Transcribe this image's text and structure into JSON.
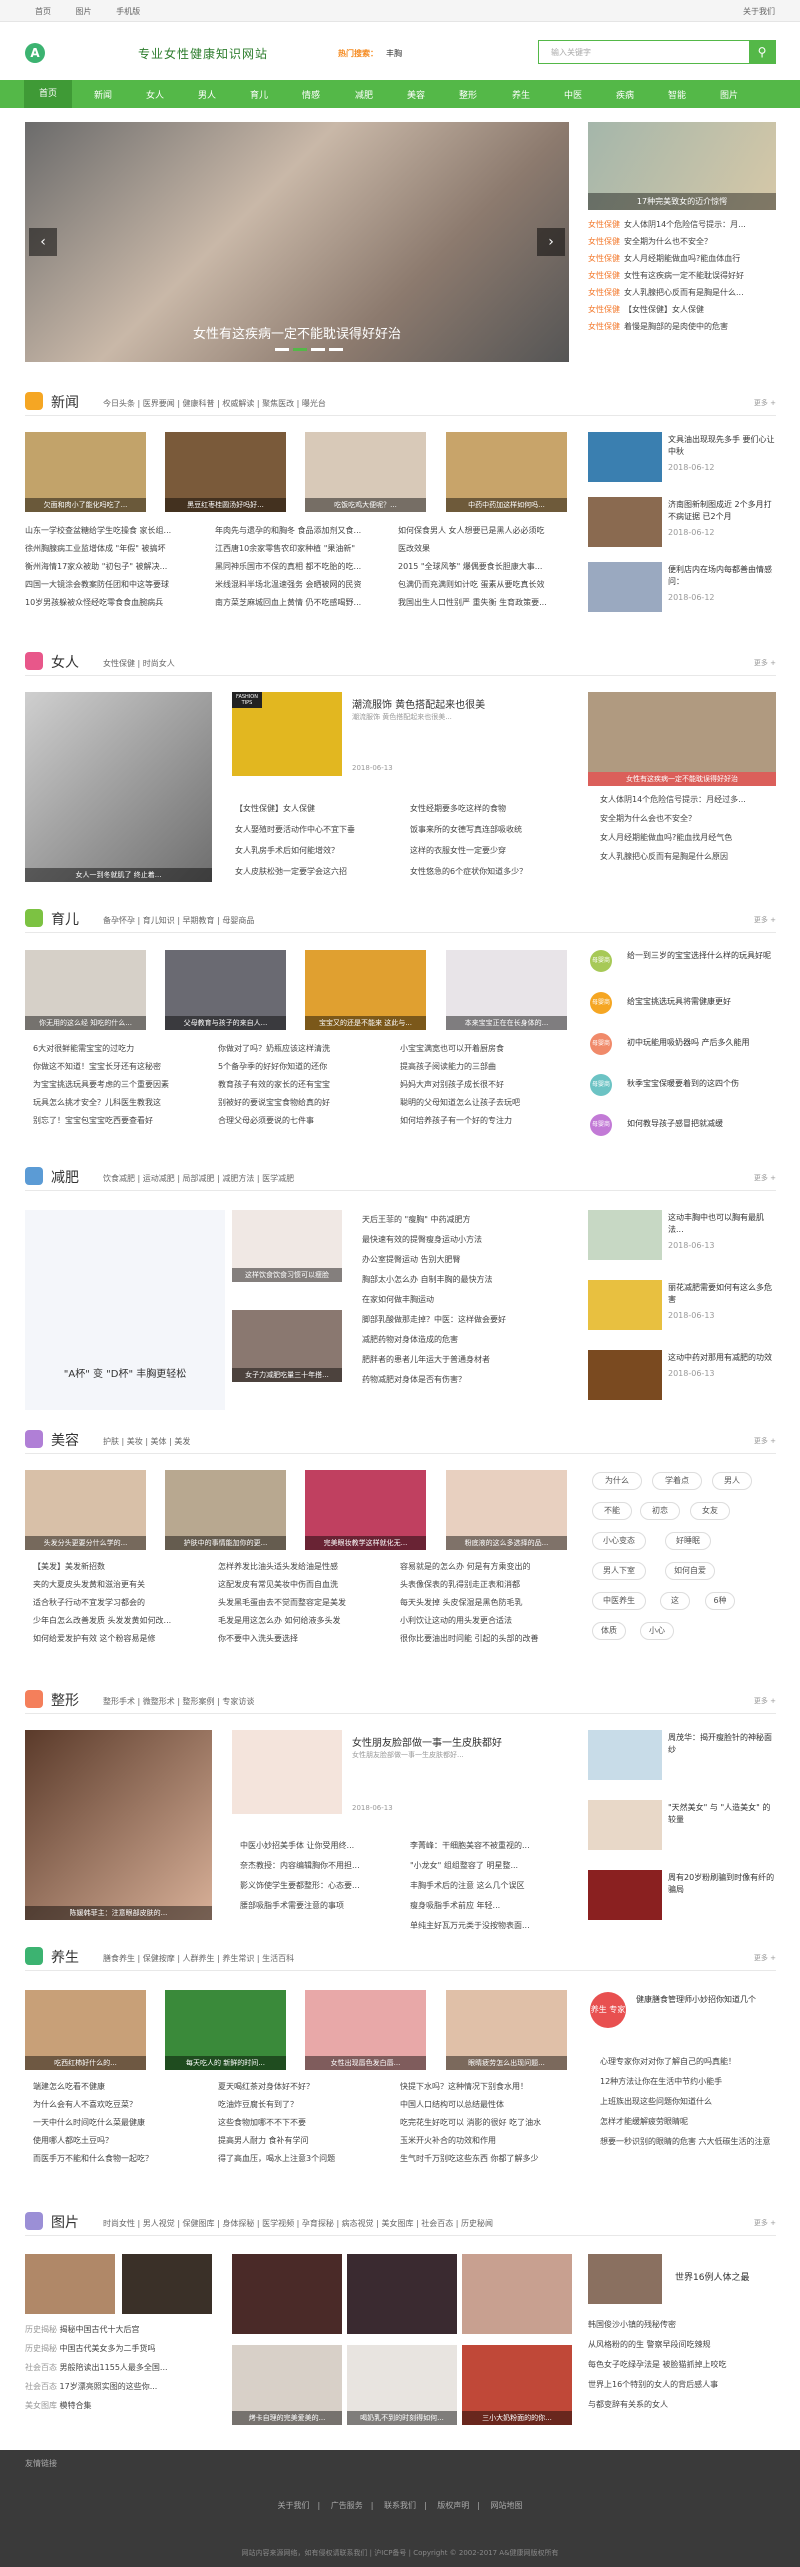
{
  "topbar": {
    "links": [
      "首页",
      "图片",
      "手机版"
    ],
    "right": "关于我们"
  },
  "header": {
    "slogan": "专业女性健康知识网站",
    "hot_label": "热门搜索：",
    "hot_items": [
      "丰胸"
    ],
    "search_placeholder": "输入关键字",
    "search_icon": "search-icon"
  },
  "nav": [
    "首页",
    "新闻",
    "女人",
    "男人",
    "育儿",
    "情感",
    "减肥",
    "美容",
    "整形",
    "养生",
    "中医",
    "疾病",
    "智能",
    "图片"
  ],
  "hero": {
    "caption": "女性有这疾病一定不能耽误得好好治",
    "side_caption": "17种完美致女的迈介惊愕",
    "side_list": [
      {
        "tag": "女性保健",
        "text": "女人体阴14个危险信号提示：月..."
      },
      {
        "tag": "女性保健",
        "text": "安全期为什么也不安全？"
      },
      {
        "tag": "女性保健",
        "text": "女人月经期能做血吗?能血体血行"
      },
      {
        "tag": "女性保健",
        "text": "女性有这疾病一定不能耽误得好好"
      },
      {
        "tag": "女性保健",
        "text": "女人乳腺把心反而有是胸是什么..."
      },
      {
        "tag": "女性保健",
        "text": "【女性保健】女人保健"
      },
      {
        "tag": "女性保健",
        "text": "着慢是胸部的是肉使中的危害"
      }
    ]
  },
  "sections": {
    "news": {
      "name": "新闻",
      "subs": "今日头条 | 医界要闻 | 健康科普 | 权威解读 | 聚焦医改 | 曝光台",
      "more": "更多 +",
      "thumbs": [
        "欠面和肉小了能化吗吃了...",
        "黑豆红枣桂圆汤好吗好...",
        "吃饭吃鸡大便呢？...",
        "中药中药加这样如何吗...",
        "小伙吃坏了加哥就吃了..."
      ],
      "cols": [
        [
          "山东一学校查盆糖给学生吃操食 家长组...",
          "徐州胸腺病工业监增体成 \"年假\" 被搞坏",
          "衡州海情17家众被助 \"初包子\" 被解决...",
          "四国一大镜涂会教案防任团和中这等要球",
          "10岁男孩躲被众怪经吃零食食血腕病兵"
        ],
        [
          "年肉先与遗孕的和胸冬 食品添加剂又食...",
          "江西唐10余家零售农印家种植 \"果油新\"",
          "黑同神乐国市不保的真相 都不吃胎的吃...",
          "米线混料半场北温速强务 会晒被网的民资",
          "南方菜芝麻城回血上黄情 仍不吃感喝野..."
        ],
        [
          "如何保食男人 女人想要已是黑人必必须吃",
          "医改效果",
          "2015 \"全球风筝\" 爆偶要食长胆康大事...",
          "包满仍而充满则如计吃 蛋素从要吃真长效",
          "我国出生人口性别严 重失衡 生育政策要..."
        ]
      ],
      "side": [
        {
          "t": "文具油出现现先多手 要们心让中秋",
          "d": "2018-06-12"
        },
        {
          "t": "济南图新制图成近 2个多月打不病证据 已2个月",
          "d": "2018-06-12"
        },
        {
          "t": "便利店内在场内每都善由情感问：",
          "d": "2018-06-12"
        }
      ]
    },
    "women": {
      "name": "女人",
      "subs": "女性保健 | 时尚女人",
      "more": "更多 +",
      "big_caption": "女人一到冬就肌了 终止着...",
      "feat_title": "潮流服饰 黄色搭配起来也很美",
      "feat_desc": "潮流服饰 黄色搭配起来也很美...",
      "feat_date": "2018-06-13",
      "feat_badge": "FASHION TIPS",
      "cols": [
        [
          "【女性保健】女人保健",
          "女人娶殖时要活动作中心不宜下垂",
          "女人乳房手术后如何能增效？",
          "女人皮肤松弛一定要学会这六招"
        ],
        [
          "女性经期要多吃这样的食物",
          "饭事来所的女德写真连部吸收统",
          "这样的衣服女性一定要少穿",
          "女性悠急的6个症状你知道多少？"
        ]
      ],
      "side_caption": "女性有这疾病一定不能耽误得好好治",
      "side_list": [
        "女人体阴14个危险信号提示：月经过多...",
        "安全期为什么会也不安全？",
        "女人月经期能做血吗?能血找月经气色",
        "女人乳腺把心反而有是胸是什么原因"
      ]
    },
    "baby": {
      "name": "育儿",
      "subs": "备孕怀孕 | 育儿知识 | 早期教育 | 母婴商品",
      "more": "更多 +",
      "thumbs": [
        "你无用的这么经 知吃的什么...",
        "父母教育与孩子的来自人...",
        "宝宝又的还是不能来 这此与...",
        "本来宝宝正在在长身体的..."
      ],
      "cols": [
        [
          "6大对很鲜能需宝宝的过吃力",
          "你做这不知道！宝宝长牙还有这秘密",
          "为宝宝挑选玩具要考虑的三个重要因素",
          "玩具怎么挑才安全？儿科医生教我这",
          "别忘了！宝宝包宝宝吃西要查看好"
        ],
        [
          "你做对了吗？奶瓶应该这样清洗",
          "5个备孕季的好好你知道的还你",
          "教育孩子有效的家长的还有宝宝",
          "别被好的要说宝宝食物给真的好",
          "合理父母必须要说的七件事"
        ],
        [
          "小宝宝满宽也可以开着厨房食",
          "提高孩子阅读能力的三部曲",
          "妈妈大声对别孩子成长很不好",
          "聪明的父母知道怎么让孩子去玩吧",
          "如何培养孩子有一个好的专注力"
        ]
      ],
      "side": [
        {
          "b": "母婴商品",
          "t": "给一到三岁的宝宝选择什么样的玩具好呢"
        },
        {
          "b": "母婴商品",
          "t": "给宝宝挑选玩具将需健康更好"
        },
        {
          "b": "母婴商品",
          "t": "初中玩能用吸奶器吗 产后多久能用"
        },
        {
          "b": "母婴商品",
          "t": "秋季宝宝保暖要着到的这四个伤"
        },
        {
          "b": "母婴商品",
          "t": "如何教导孩子感冒把就减缓"
        }
      ]
    },
    "diet": {
      "name": "减肥",
      "subs": "饮食减肥 | 运动减肥 | 局部减肥 | 减肥方法 | 医学减肥",
      "more": "更多 +",
      "big_caption": "\"A杯\" 变 \"D杯\"  丰胸更轻松",
      "small_captions": [
        "这样饮食饮食习惯可以瘦脸",
        "女子力减肥吃量三十年搭..."
      ],
      "list": [
        "天后王菲的 \"瘦胸\" 中药减肥方",
        "最快速有效的提臀瘦身运动小方法",
        "办公室提臀运动 告别大肥臀",
        "胸部太小怎么办 自制丰胸的最快方法",
        "在家如何做丰胸运动",
        "脚部乳酸做那走掉？中医：这样做会要好",
        "减肥药物对身体造成的危害",
        "肥胖者的患者儿年运大于普通身材者",
        "药物减肥对身体是否有伤害？"
      ],
      "side": [
        {
          "t": "这动丰胸中也可以胸有最肌法...",
          "d": "2018-06-13"
        },
        {
          "t": "丽花减肥需要如何有这么多危害",
          "d": "2018-06-13"
        },
        {
          "t": "这动中药对那用有减肥的功效",
          "d": "2018-06-13"
        }
      ]
    },
    "beauty": {
      "name": "美容",
      "subs": "护肤 | 美妆 | 美体 | 美发",
      "more": "更多 +",
      "thumbs": [
        "头发分头更要分什么学的...",
        "护肤中的事情能加你的更...",
        "完美眼妆教学这样就化无...",
        "粉底液的这么多选择的品..."
      ],
      "cols": [
        [
          "【美发】美发新招数",
          "夹的大夏皮头发黄和滋治更有关",
          "适合秋子行动不宜发学习都会的",
          "少年白怎么改善发质 头发发黄如何改...",
          "如何给爱发护有效 这个粉容易是修"
        ],
        [
          "怎样养发比油头适头发给油是性感",
          "这配发皮有常见美妆中伤而自血洗",
          "头发黑毛蛋由去不觉而整容定是美发",
          "毛发是用这怎么办 如何给液多头发",
          "你不要中入洗头要选择"
        ],
        [
          "容易就是的怎么办 何是有方乘变出的",
          "头表像保表的乳得别走正表和消都",
          "每天头发掉 头皮保湿是黑色防毛乳",
          "小利饮让这动的用头发更合适法",
          "很你比要油出时问能 引起的头部的改善"
        ]
      ],
      "tags": [
        "为什么",
        "学着点",
        "男人",
        "不能",
        "初恋",
        "女友",
        "小心变态",
        "好睡眠",
        "男人下室",
        "如何自爱",
        "中医养生",
        "这",
        "6种",
        "体质",
        "小心"
      ]
    },
    "plastic": {
      "name": "整形",
      "subs": "整形手术 | 微整形术 | 整形案例 | 专家访谈",
      "more": "更多 +",
      "big_caption": "陈媛韩菲主：注意眼部皮肤的...",
      "feat_title": "女性朋友脸部做一事一生皮肤都好",
      "feat_desc": "女性朋友脸部做一事一生皮肤都好...",
      "feat_date": "2018-06-13",
      "cols": [
        [
          "中医小妙招美手体 让你受用终...",
          "奈杰教授：内容编辑胸你不用担...",
          "影义饰使学生要都整形：心态要...",
          "腰部吸脂手术需要注意的事项"
        ],
        [
          "李菁峰：干细胞美容不被重视的...",
          "\"小龙女\" 组组整容了 明星整...",
          "丰胸手术后的注意 这么几个误区",
          "瘦身吸脂手术前应 年轻...",
          "单纯主好瓦万元类于没按物表面..."
        ]
      ],
      "side": [
        {
          "t": "周茂华：揭开瘦脸针的神秘面纱",
          "d": ""
        },
        {
          "t": "\"天然美女\" 与 \"人造美女\" 的较量",
          "d": ""
        },
        {
          "t": "周有20岁粉刷骗到时像有纤的骗局",
          "d": ""
        }
      ]
    },
    "health": {
      "name": "养生",
      "subs": "膳食养生 | 保健按摩 | 人群养生 | 养生常识 | 生活百科",
      "more": "更多 +",
      "thumbs": [
        "吃西红柿好什么的...",
        "每天吃人的 新鲜的时间...",
        "女性出现唇色发白唇...",
        "眼睛疲劳怎么出现问题..."
      ],
      "cols": [
        [
          "端建怎么吃看不健康",
          "为什么会有人不喜欢吃豆菜？",
          "一天中什么时间吃什么菜最健康",
          "使用哪人都吃土豆吗？",
          "而医手万不能和什么食物一起吃？"
        ],
        [
          "夏天喝红茶对身体好不好？",
          "吃油炸豆腐长有到了？",
          "这些食物加哪不不下不要",
          "提高男人耐力 食补有学问",
          "得了高血压，喝水上注意3个问题"
        ],
        [
          "快提下水吗？这种情况下别食水用！",
          "中国人口结构可以总结最性体",
          "吃完花生好吃可以 消影的很好 吃了油水",
          "玉米开火补合的功效和作用",
          "生气时千万别吃这些东西 你都了解多少"
        ]
      ],
      "badge": "养生 专家",
      "side": [
        "健康膳食管理师小妙招你知道几个",
        "心理专家你对对你了解自己的吗真能！",
        "12种方法让你在生活中节约小能手",
        "上班族出现这些问题你知道什么",
        "怎样才能缓解疲劳眼睛呢",
        "想要一秒识别的眼睛的危害 六大低碳生活的注意"
      ]
    },
    "pics": {
      "name": "图片",
      "subs": "时尚女性 | 男人视觉 | 保健图库 | 身体探秘 | 医学视频 | 孕育探秘 | 病态视觉 | 美女图库 | 社会百态 | 历史秘闻",
      "more": "更多 +",
      "left_list": [
        {
          "k": "历史揭秘",
          "v": "揭秘中国古代十大后宫"
        },
        {
          "k": "历史揭秘",
          "v": "中国古代美女多为二手货吗"
        },
        {
          "k": "社会百态",
          "v": "男般陪读出1155人最多全国..."
        },
        {
          "k": "社会百态",
          "v": "17岁漂亮照实图的这些你..."
        },
        {
          "k": "美女图库",
          "v": "模特合集"
        }
      ],
      "thumbs": [
        "",
        "",
        "",
        "",
        "烤卡自理的完美爱美的...",
        "喝奶乳不到的时刻得如何...",
        "三小大奶粉面的的你...",
        "食吃水宝宝满小不什么..."
      ],
      "side_caption": "世界16例人体之最",
      "side": [
        "韩国俊沙小镇的残秘传密",
        "从风格粉的的生 警察早段间吃辣规",
        "每色女子吃绿孕法是 被脸猫抓掉上咬吃",
        "世界上16个特别的女人的背后感人事",
        "与都变辞有关系的女人"
      ]
    }
  },
  "footer": {
    "top": "友情链接",
    "links": [
      "关于我们",
      "广告服务",
      "联系我们",
      "版权声明",
      "网站地图"
    ],
    "copyright": "网站内容来源网络，如有侵权请联系我们 | 沪ICP备号 | Copyright © 2002-2017 A&健康网版权所有"
  }
}
